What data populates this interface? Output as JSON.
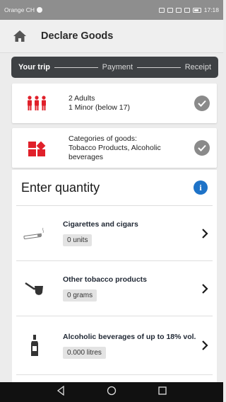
{
  "status_bar": {
    "carrier": "Orange CH",
    "time": "17:18"
  },
  "header": {
    "title": "Declare Goods"
  },
  "stepper": {
    "steps": [
      "Your trip",
      "Payment",
      "Receipt"
    ]
  },
  "travellers": {
    "line1": "2 Adults",
    "line2": "1 Minor (below 17)"
  },
  "categories": {
    "line1": "Categories of goods:",
    "line2": "Tobacco Products, Alcoholic beverages"
  },
  "quantity": {
    "title": "Enter quantity",
    "items": [
      {
        "label": "Cigarettes and cigars",
        "value": "0 units"
      },
      {
        "label": "Other tobacco products",
        "value": "0 grams"
      },
      {
        "label": "Alcoholic beverages of up to 18% vol.",
        "value": "0.000 litres"
      }
    ]
  },
  "colors": {
    "accent_red": "#e0202a",
    "info_blue": "#1e73c8",
    "stepper_bg": "#3e4144"
  }
}
